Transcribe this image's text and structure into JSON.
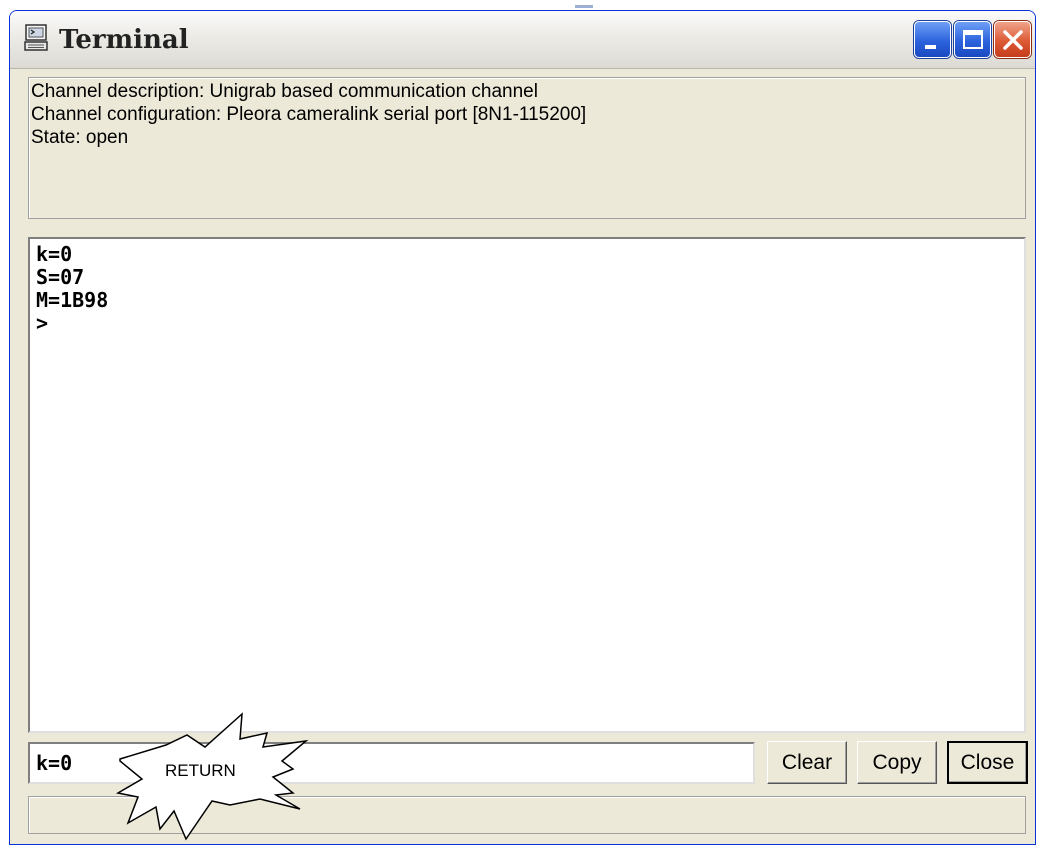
{
  "window": {
    "title": "Terminal",
    "title_icon": "terminal-app-icon",
    "controls": [
      "minimize-icon",
      "maximize-icon",
      "close-icon"
    ]
  },
  "info": {
    "description": "Channel description: Unigrab based communication channel",
    "configuration": "Channel configuration: Pleora cameralink serial port [8N1-115200]",
    "state": "State: open"
  },
  "terminal": {
    "lines": [
      "k=0",
      "S=07",
      "M=1B98",
      ">"
    ]
  },
  "input": {
    "value": "k=0"
  },
  "buttons": {
    "clear": "Clear",
    "copy": "Copy",
    "close": "Close"
  },
  "annotation": {
    "label": "RETURN"
  },
  "status": {
    "text": ""
  }
}
